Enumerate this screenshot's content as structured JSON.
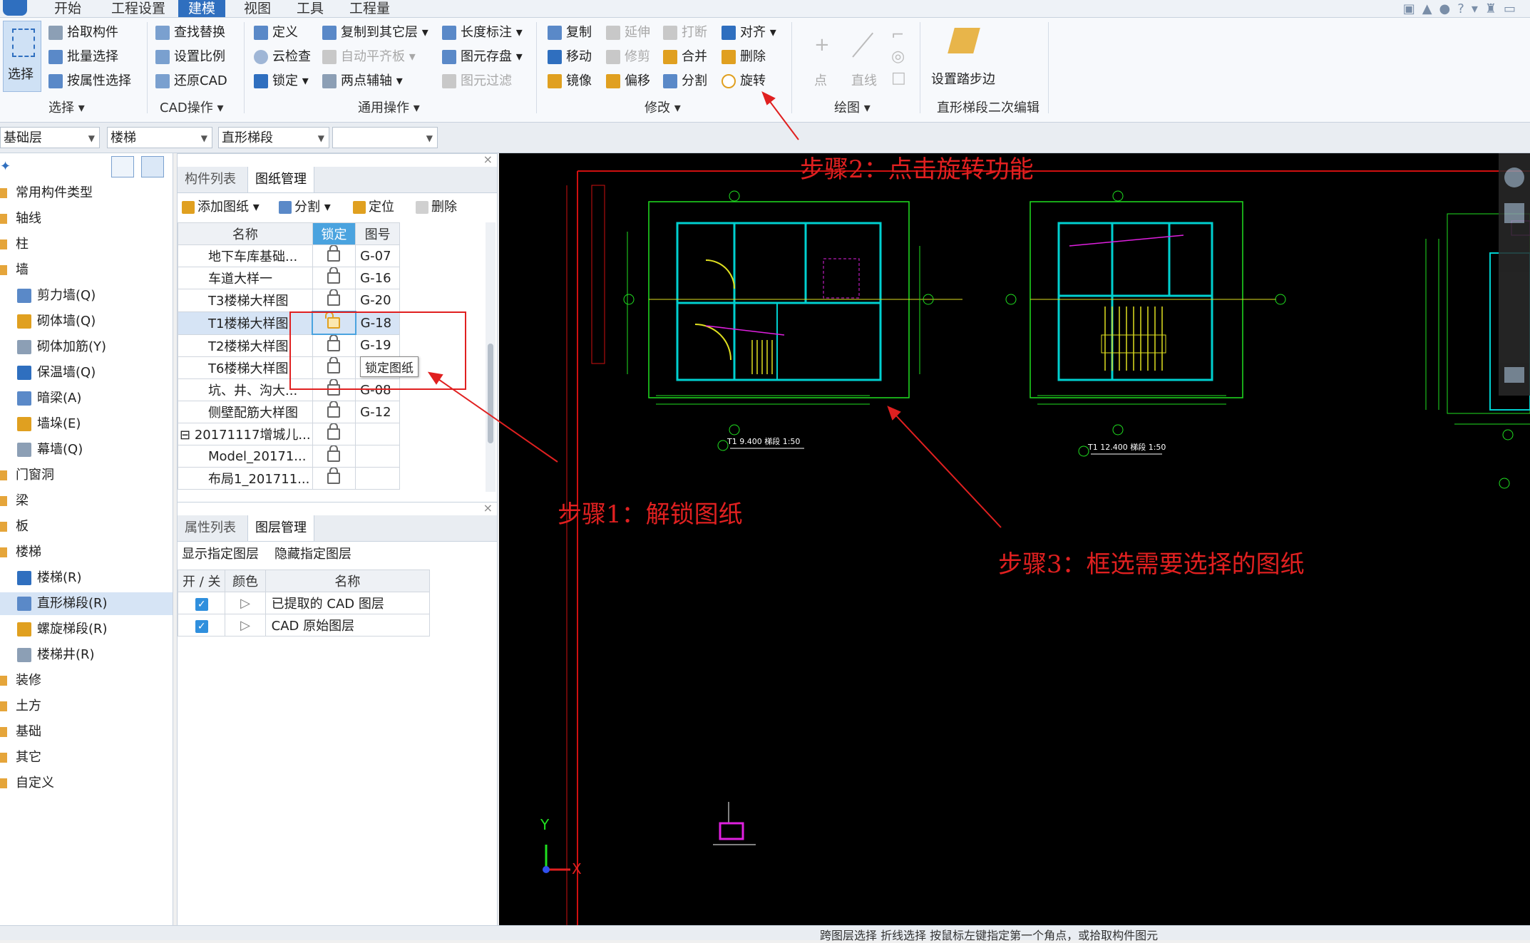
{
  "menu": {
    "tabs": [
      "开始",
      "工程设置",
      "建模",
      "视图",
      "工具",
      "工程量"
    ],
    "active": "建模"
  },
  "ribbon": {
    "select_group": {
      "big_button": "选择",
      "items": [
        "拾取构件",
        "批量选择",
        "按属性选择"
      ],
      "label": "选择"
    },
    "cad_group": {
      "items": [
        "查找替换",
        "设置比例",
        "还原CAD"
      ],
      "label": "CAD操作"
    },
    "common_group": {
      "col1": [
        "定义",
        "云检查",
        "锁定"
      ],
      "col2": [
        "复制到其它层",
        "自动平齐板",
        "两点辅轴"
      ],
      "col3": [
        "长度标注",
        "图元存盘",
        "图元过滤"
      ],
      "label": "通用操作"
    },
    "modify_group": {
      "col1": [
        "复制",
        "移动",
        "镜像"
      ],
      "col2": [
        "延伸",
        "修剪",
        "偏移"
      ],
      "col3": [
        "打断",
        "合并",
        "分割"
      ],
      "col4": [
        "对齐",
        "删除",
        "旋转"
      ],
      "label": "修改"
    },
    "draw_group": {
      "items": [
        "点",
        "直线"
      ],
      "label": "绘图"
    },
    "stair_group": {
      "big_button": "设置踏步边",
      "label": "直形梯段二次编辑"
    }
  },
  "selectors": {
    "floor": "基础层",
    "category": "楼梯",
    "type": "直形梯段",
    "extra": ""
  },
  "tree": {
    "items": [
      {
        "label": "常用构件类型",
        "level": 0
      },
      {
        "label": "轴线",
        "level": 0
      },
      {
        "label": "柱",
        "level": 0
      },
      {
        "label": "墙",
        "level": 0
      },
      {
        "label": "剪力墙(Q)",
        "level": 1
      },
      {
        "label": "砌体墙(Q)",
        "level": 1
      },
      {
        "label": "砌体加筋(Y)",
        "level": 1
      },
      {
        "label": "保温墙(Q)",
        "level": 1
      },
      {
        "label": "暗梁(A)",
        "level": 1
      },
      {
        "label": "墙垛(E)",
        "level": 1
      },
      {
        "label": "幕墙(Q)",
        "level": 1
      },
      {
        "label": "门窗洞",
        "level": 0
      },
      {
        "label": "梁",
        "level": 0
      },
      {
        "label": "板",
        "level": 0
      },
      {
        "label": "楼梯",
        "level": 0
      },
      {
        "label": "楼梯(R)",
        "level": 1
      },
      {
        "label": "直形梯段(R)",
        "level": 1,
        "selected": true
      },
      {
        "label": "螺旋梯段(R)",
        "level": 1
      },
      {
        "label": "楼梯井(R)",
        "level": 1
      },
      {
        "label": "装修",
        "level": 0
      },
      {
        "label": "土方",
        "level": 0
      },
      {
        "label": "基础",
        "level": 0
      },
      {
        "label": "其它",
        "level": 0
      },
      {
        "label": "自定义",
        "level": 0
      }
    ]
  },
  "drawing_panel": {
    "tabs": [
      "构件列表",
      "图纸管理"
    ],
    "active_tab": "图纸管理",
    "toolbar": [
      "添加图纸",
      "分割",
      "定位",
      "删除"
    ],
    "columns": [
      "名称",
      "锁定",
      "图号"
    ],
    "rows": [
      {
        "name": "地下车库基础...",
        "locked": true,
        "code": "G-07"
      },
      {
        "name": "车道大样一",
        "locked": true,
        "code": "G-16"
      },
      {
        "name": "T3楼梯大样图",
        "locked": true,
        "code": "G-20"
      },
      {
        "name": "T1楼梯大样图",
        "locked": false,
        "code": "G-18",
        "selected": true
      },
      {
        "name": "T2楼梯大样图",
        "locked": true,
        "code": "G-19"
      },
      {
        "name": "T6楼梯大样图",
        "locked": true,
        "code": ""
      },
      {
        "name": "坑、井、沟大...",
        "locked": true,
        "code": "G-08"
      },
      {
        "name": "侧壁配筋大样图",
        "locked": true,
        "code": "G-12"
      },
      {
        "name": "20171117增城儿...",
        "locked": true,
        "code": "",
        "group": true
      },
      {
        "name": "Model_20171...",
        "locked": true,
        "code": ""
      },
      {
        "name": "布局1_201711...",
        "locked": true,
        "code": ""
      }
    ],
    "tooltip": "锁定图纸"
  },
  "layer_panel": {
    "tabs": [
      "属性列表",
      "图层管理"
    ],
    "active_tab": "图层管理",
    "toolbar": [
      "显示指定图层",
      "隐藏指定图层"
    ],
    "columns": [
      "开 / 关",
      "颜色",
      "名称"
    ],
    "rows": [
      {
        "on": true,
        "name": "已提取的 CAD 图层"
      },
      {
        "on": true,
        "name": "CAD 原始图层"
      }
    ]
  },
  "annotations": {
    "step1": "步骤1：解锁图纸",
    "step2": "步骤2：点击旋转功能",
    "step3": "步骤3：框选需要选择的图纸"
  },
  "canvas": {
    "axis_x": "X",
    "axis_y": "Y",
    "drawing1_caption": "T1  9.400  梯段   1:50",
    "drawing2_caption": "T1  12.400  梯段   1:50"
  },
  "status": {
    "text": "跨图层选择   折线选择   按鼠标左键指定第一个角点，或拾取构件图元"
  }
}
